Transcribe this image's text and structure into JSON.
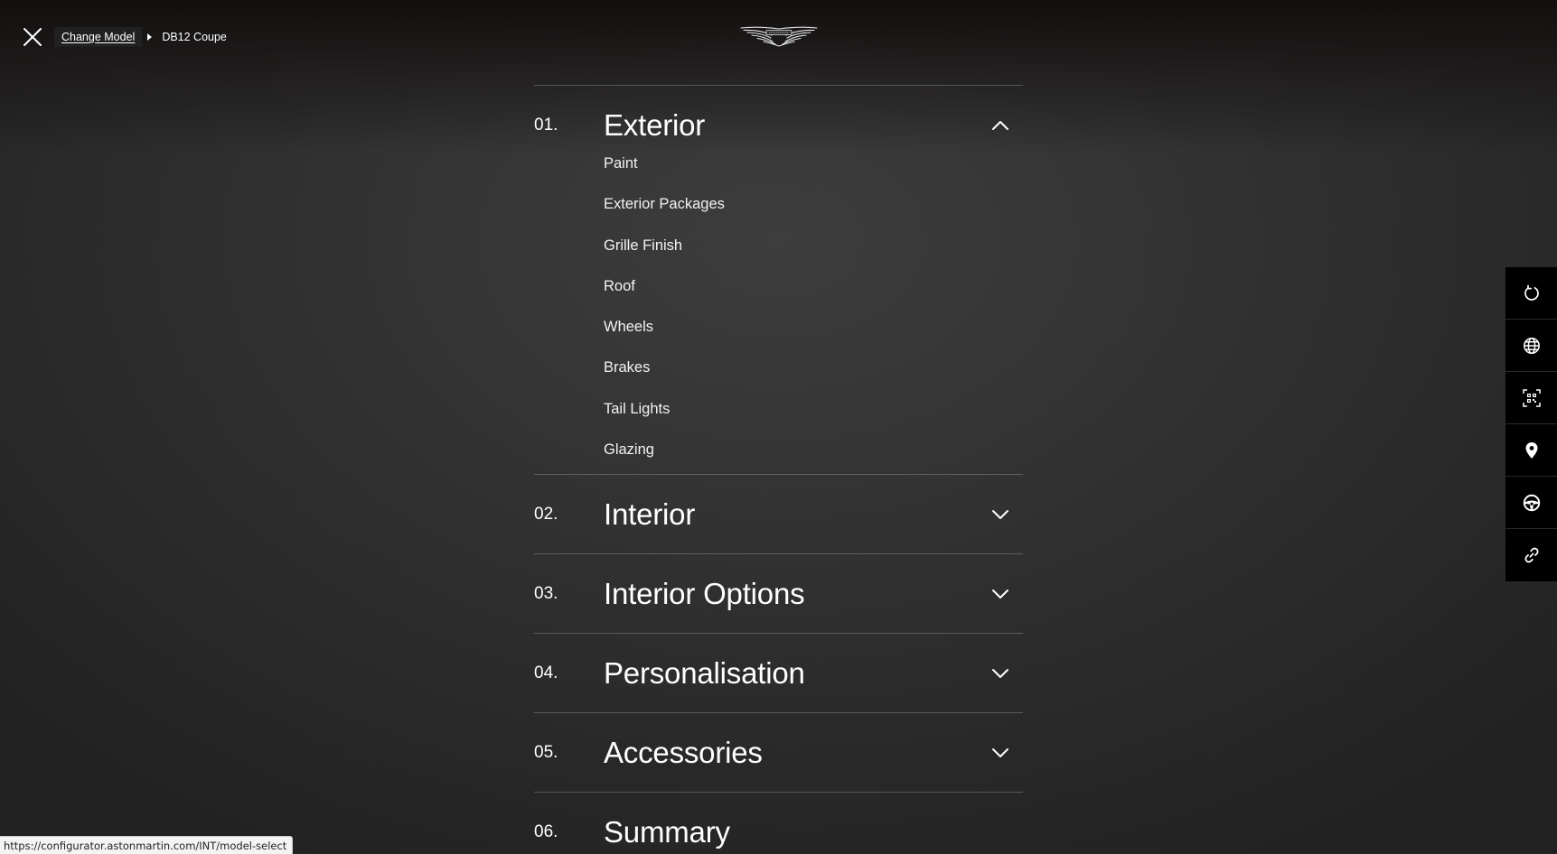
{
  "header": {
    "close_icon": "close-icon",
    "breadcrumb": {
      "link_label": "Change Model",
      "current_label": "DB12 Coupe"
    },
    "logo_icon": "aston-martin-wings-logo"
  },
  "sections": [
    {
      "number": "01.",
      "title": "Exterior",
      "expanded": true,
      "items": [
        "Paint",
        "Exterior Packages",
        "Grille Finish",
        "Roof",
        "Wheels",
        "Brakes",
        "Tail Lights",
        "Glazing"
      ]
    },
    {
      "number": "02.",
      "title": "Interior",
      "expanded": false
    },
    {
      "number": "03.",
      "title": "Interior Options",
      "expanded": false
    },
    {
      "number": "04.",
      "title": "Personalisation",
      "expanded": false
    },
    {
      "number": "05.",
      "title": "Accessories",
      "expanded": false
    },
    {
      "number": "06.",
      "title": "Summary",
      "expanded": false
    }
  ],
  "toolbar": {
    "icons": [
      "reset-icon",
      "globe-icon",
      "qr-code-icon",
      "location-pin-icon",
      "steering-wheel-icon",
      "link-icon"
    ]
  },
  "status_bar": {
    "url": "https://configurator.astonmartin.com/INT/model-select"
  },
  "colors": {
    "background": "#333333",
    "text": "#ffffff",
    "divider": "#5a5a5a",
    "toolbar": "#000000"
  }
}
